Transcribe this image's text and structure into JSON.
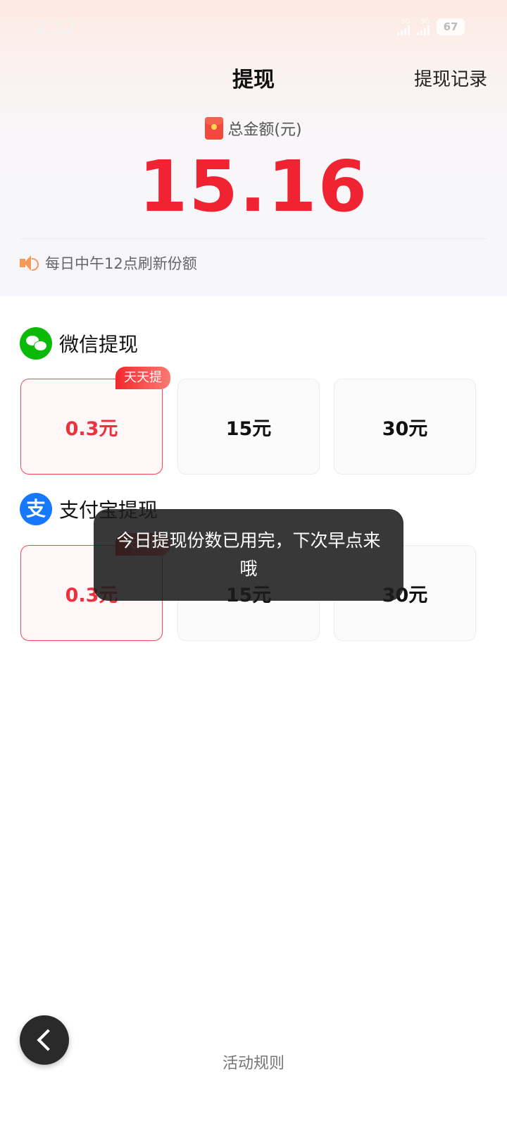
{
  "status_bar": {
    "time": "2:32",
    "network_label": "5G",
    "battery": "67"
  },
  "header": {
    "title": "提现",
    "record_link": "提现记录"
  },
  "summary": {
    "total_label": "总金额(元)",
    "total_amount": "15.16",
    "notice": "每日中午12点刷新份额"
  },
  "wechat": {
    "title": "微信提现",
    "badge": "天天提",
    "options": [
      "0.3元",
      "15元",
      "30元"
    ],
    "selected_index": 0
  },
  "alipay": {
    "title": "支付宝提现",
    "icon_glyph": "支",
    "options": [
      "0.3元",
      "15元",
      "30元"
    ],
    "selected_index": 0
  },
  "toast": {
    "message": "今日提现份数已用完，下次早点来哦"
  },
  "footer": {
    "rules_link": "活动规则"
  },
  "colors": {
    "accent_red": "#ef2331",
    "wechat_green": "#09bb07",
    "alipay_blue": "#1677ff"
  },
  "icons": [
    "wechat-icon",
    "alipay-icon",
    "redpacket-icon",
    "speaker-icon",
    "back-chevron-icon"
  ]
}
